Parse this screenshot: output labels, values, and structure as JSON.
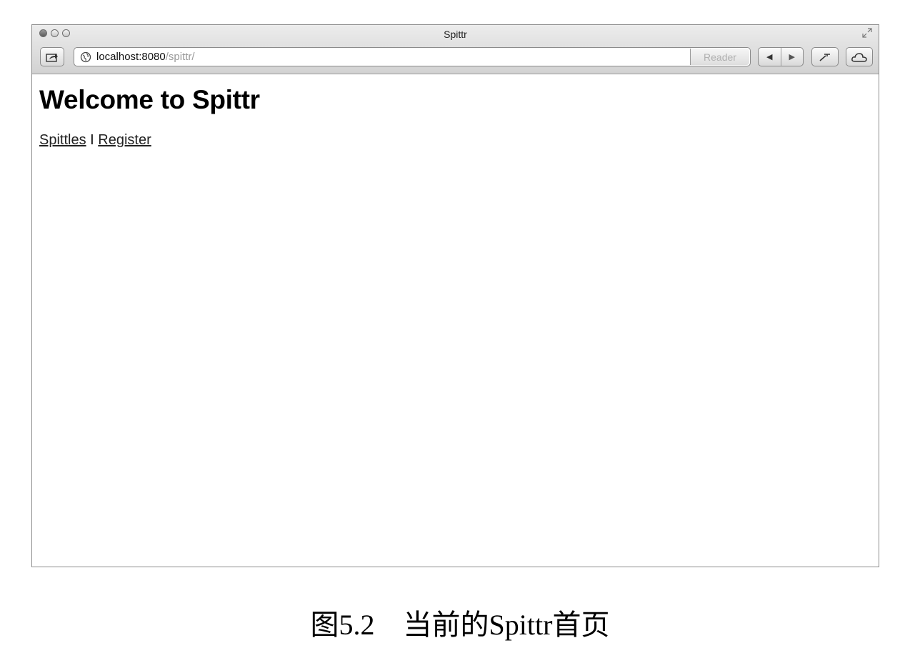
{
  "window": {
    "title": "Spittr"
  },
  "toolbar": {
    "url_host": "localhost:8080",
    "url_path": "/spittr/",
    "reader_label": "Reader"
  },
  "page": {
    "heading": "Welcome to Spittr",
    "links": {
      "spittles": "Spittles",
      "separator": " I ",
      "register": "Register"
    }
  },
  "figure": {
    "caption_number": "图5.2",
    "caption_text": "当前的Spittr首页"
  }
}
